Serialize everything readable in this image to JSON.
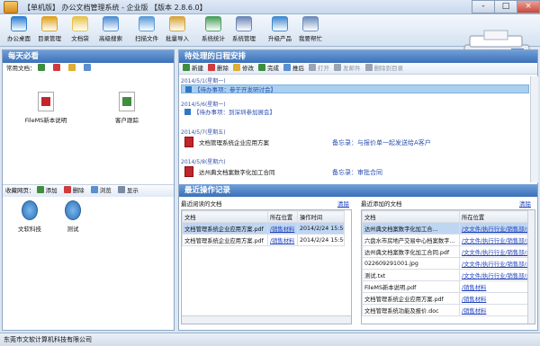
{
  "window": {
    "title": "【单机版】 办公文档管理系统 - 企业版 【版本 2.8.6.0】",
    "controls": [
      "-",
      "□",
      "×"
    ]
  },
  "toolbar": {
    "items": [
      {
        "label": "办公桌面",
        "icon": "home-icon",
        "color": "#2d7fd3"
      },
      {
        "label": "目录管理",
        "icon": "folder-tree-icon",
        "color": "#e0a21c"
      },
      {
        "label": "文档袋",
        "icon": "document-bag-icon",
        "color": "#e7c348"
      },
      {
        "label": "高级搜索",
        "icon": "search-icon",
        "color": "#4f8fd3"
      },
      {
        "label": "扫描文件",
        "icon": "scanner-icon",
        "color": "#5a9bd8"
      },
      {
        "label": "批量导入",
        "icon": "batch-import-icon",
        "color": "#d9a43a"
      },
      {
        "label": "系统统计",
        "icon": "statistics-icon",
        "color": "#49a05c"
      },
      {
        "label": "系统管理",
        "icon": "system-settings-icon",
        "color": "#6b86b6"
      },
      {
        "label": "升级产品",
        "icon": "upgrade-icon",
        "color": "#3f8ad0"
      },
      {
        "label": "我要帮忙",
        "icon": "help-icon",
        "color": "#6c8dbd"
      }
    ]
  },
  "left": {
    "header": "每天必看",
    "common_docs_label": "常用文档：",
    "docs": [
      {
        "name": "FileMS新本说明",
        "icon": "pdf-file-icon"
      },
      {
        "name": "客户跟踪",
        "icon": "spreadsheet-file-icon"
      }
    ],
    "fav_label": "收藏网页：",
    "fav_toolbar": [
      "添加",
      "删除",
      "浏览",
      "显示"
    ],
    "favs": [
      {
        "name": "文软科技",
        "icon": "globe-icon"
      },
      {
        "name": "测试",
        "icon": "globe-icon"
      }
    ]
  },
  "schedule": {
    "header": "待处理的日程安排",
    "toolbar": [
      "新建",
      "删除",
      "修改",
      "完成",
      "推后",
      "打开",
      "发邮件",
      "删除到目录"
    ],
    "items": [
      {
        "date": "2014/5/1(星期一)",
        "text": "【待办事项：参于开发研讨会】",
        "selected": true
      },
      {
        "date": "2014/5/6(星期一)",
        "text": "【待办事项：到深圳参加展会】"
      },
      {
        "date": "2014/5/7(星期五)",
        "text": "文档管理系统企业应用方案",
        "note": "备忘录：与报价单一起发送给A客户",
        "file": true
      },
      {
        "date": "2014/5/8(星期六)",
        "text": "达州典文档案数字化加工合同",
        "note": "备忘录：审批合同",
        "file": true
      }
    ]
  },
  "recent": {
    "header": "最近操作记录",
    "read_title": "最近阅读的文档",
    "added_title": "最近添加的文档",
    "clear": "清除",
    "read_cols": [
      "文档",
      "所在位置",
      "操作时间"
    ],
    "read_rows": [
      [
        "文档管理系统企业应用方案.pdf",
        "/销售材料",
        "2014/2/24 15:56"
      ],
      [
        "文档管理系统企业应用方案.pdf",
        "/销售材料",
        "2014/2/24 15:56"
      ]
    ],
    "added_cols": [
      "文档",
      "所在位置"
    ],
    "added_rows": [
      [
        "达州典文档案数字化加工合...",
        "/文文件/执行行业/销售部/合同"
      ],
      [
        "六盘水市房地产交易中心档案数字...",
        "/文文件/执行行业/销售部/合同"
      ],
      [
        "达州典文档案数字化加工合同.pdf",
        "/文文件/执行行业/销售部/合同"
      ],
      [
        "022609291001.jpg",
        "/文文件/执行行业/销售部/合同"
      ],
      [
        "测试.txt",
        "/文文件/执行行业/销售部/合同"
      ],
      [
        "FileMS新本说明.pdf",
        "/销售材料"
      ],
      [
        "文档管理系统企业应用方案.pdf",
        "/销售材料"
      ],
      [
        "文档管理系统功能及报价.doc",
        "/销售材料"
      ]
    ]
  },
  "status": {
    "company": "东莞市文软计算机科技有限公司"
  }
}
